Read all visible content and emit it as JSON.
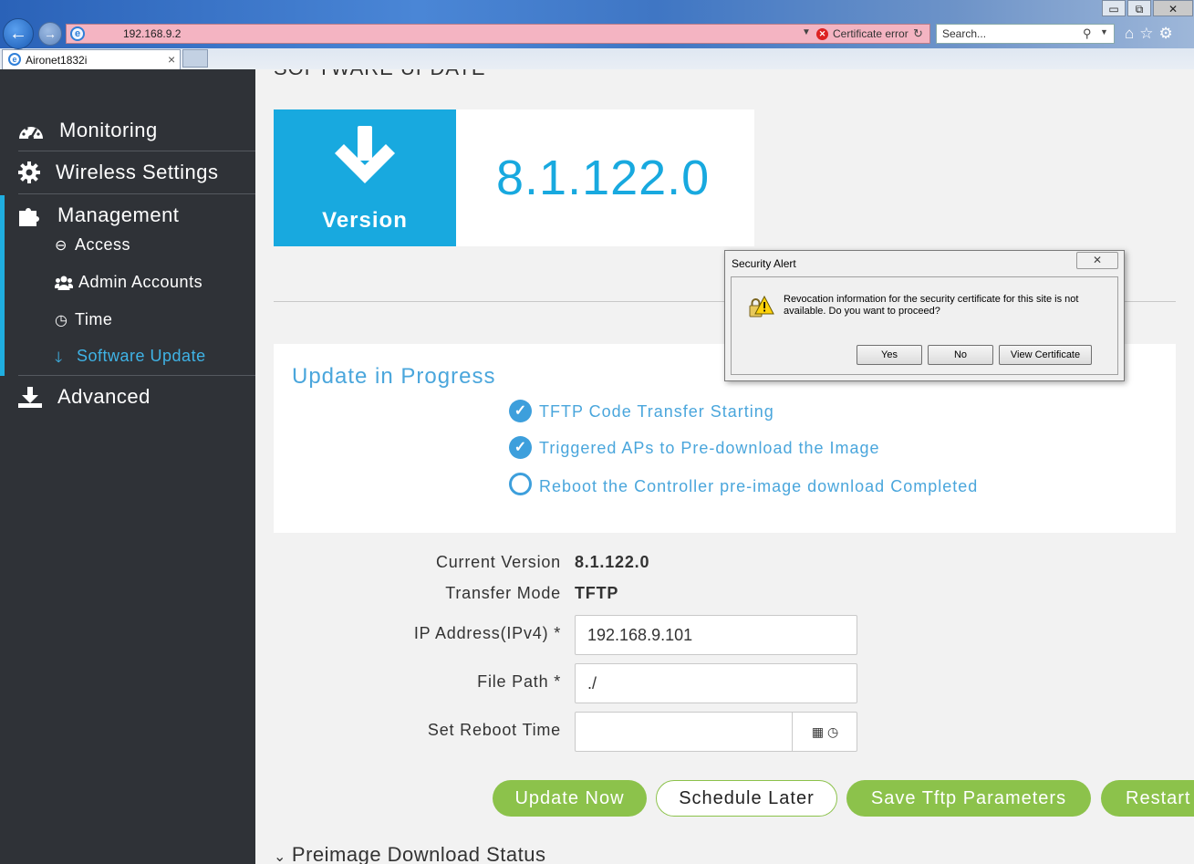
{
  "browser": {
    "url": "192.168.9.2",
    "certificate_error": "Certificate error",
    "search_placeholder": "Search...",
    "tab_title": "Aironet1832i",
    "window_controls": {
      "minimize": "▭",
      "restore": "⧉",
      "close": "✕"
    }
  },
  "sidebar": {
    "items": [
      {
        "label": "Monitoring",
        "icon": "dashboard-icon"
      },
      {
        "label": "Wireless Settings",
        "icon": "gear-icon"
      },
      {
        "label": "Management",
        "icon": "puzzle-icon"
      },
      {
        "label": "Advanced",
        "icon": "download-tray-icon"
      }
    ],
    "management_sub": [
      {
        "label": "Access",
        "icon": "minus-circle-icon"
      },
      {
        "label": "Admin Accounts",
        "icon": "users-icon"
      },
      {
        "label": "Time",
        "icon": "clock-icon"
      },
      {
        "label": "Software Update",
        "icon": "arrow-down-icon",
        "active": true
      }
    ]
  },
  "main": {
    "page_title": "SOFTWARE UPDATE",
    "version_card": {
      "label": "Version",
      "number": "8.1.122.0"
    },
    "progress": {
      "title": "Update in Progress",
      "steps": [
        {
          "text": "TFTP Code Transfer Starting",
          "done": true
        },
        {
          "text": "Triggered APs to Pre-download the Image",
          "done": true
        },
        {
          "text": "Reboot the Controller pre-image download Completed",
          "done": false
        }
      ]
    },
    "form": {
      "current_version_label": "Current Version",
      "current_version_value": "8.1.122.0",
      "transfer_mode_label": "Transfer Mode",
      "transfer_mode_value": "TFTP",
      "ip_label": "IP Address(IPv4) *",
      "ip_value": "192.168.9.101",
      "file_path_label": "File Path *",
      "file_path_value": "./",
      "reboot_label": "Set Reboot Time",
      "reboot_value": ""
    },
    "buttons": {
      "update_now": "Update Now",
      "schedule_later": "Schedule Later",
      "save_tftp": "Save Tftp Parameters",
      "restart": "Restart"
    },
    "preimage_title": "Preimage Download Status"
  },
  "dialog": {
    "title": "Security Alert",
    "message": "Revocation information for the security certificate for this site is not available. Do you want to proceed?",
    "yes": "Yes",
    "no": "No",
    "view_certificate": "View Certificate"
  },
  "colors": {
    "accent_blue": "#18a9df",
    "sidebar_bg": "#2f3237",
    "button_green": "#8cc24b",
    "active_text": "#3fb3e6"
  }
}
